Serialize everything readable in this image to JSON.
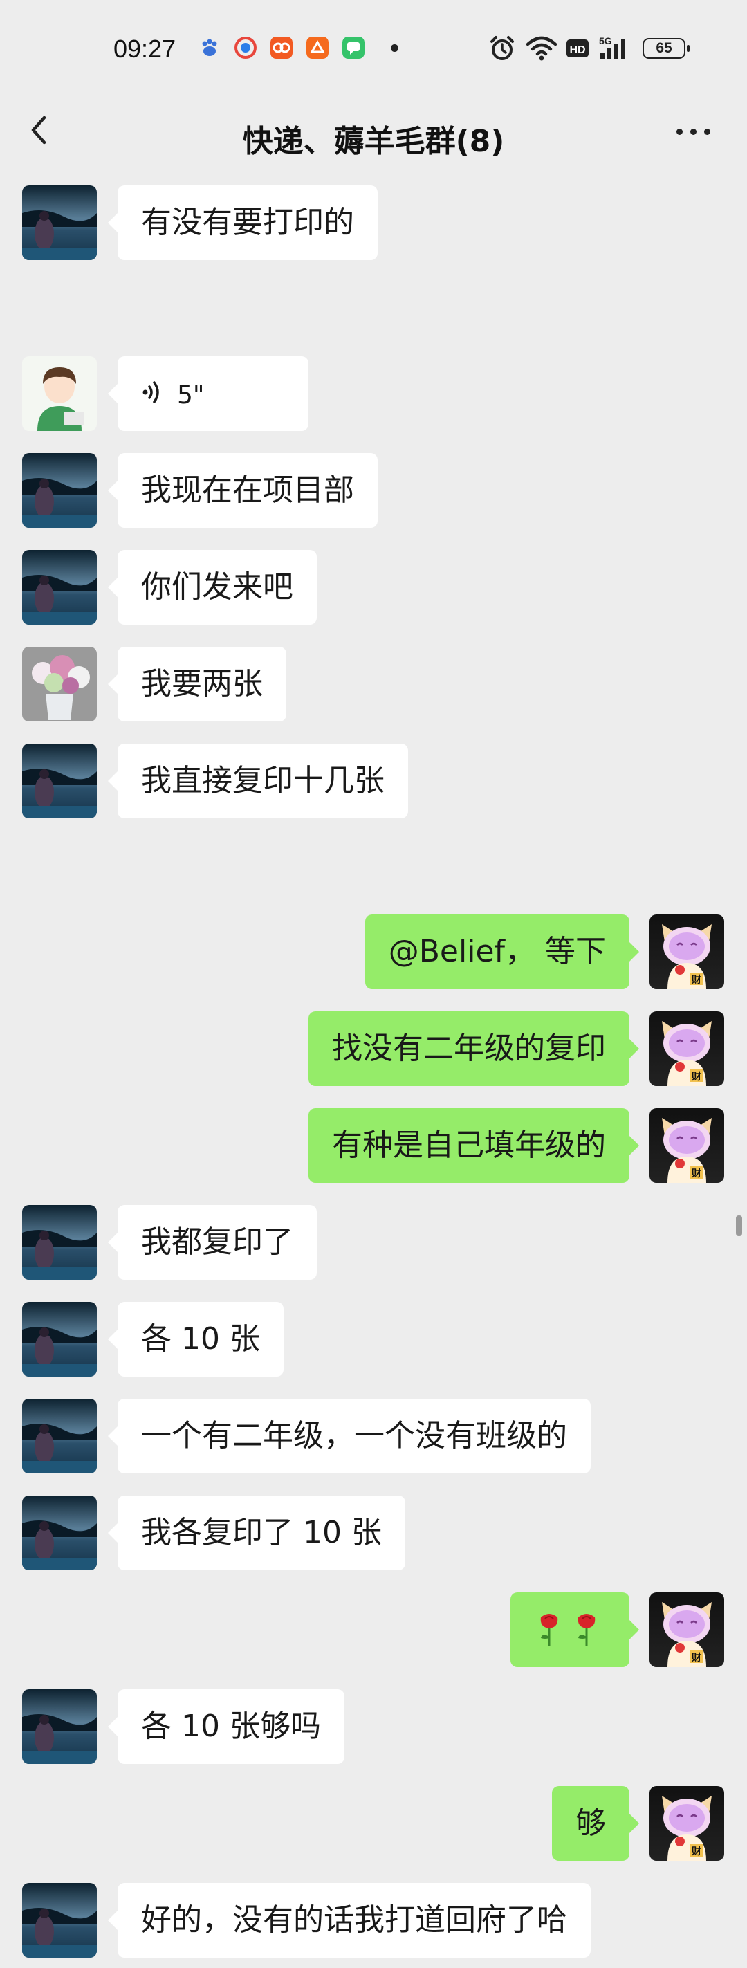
{
  "status_bar": {
    "time": "09:27",
    "battery": "65",
    "app_icon_colors": [
      "#3a72d8",
      "#e8463c",
      "#f25a22",
      "#f56a1d",
      "#35c36a"
    ],
    "icons": [
      "alarm-icon",
      "wifi-icon",
      "hd-icon",
      "5g-signal-icon",
      "battery-icon"
    ]
  },
  "header": {
    "title": "快递、薅羊毛群(8)"
  },
  "messages": [
    {
      "side": "left",
      "avatar": "lake",
      "text": "有没有要打印的"
    },
    {
      "side": "left",
      "avatar": "boy",
      "type": "voice",
      "text": "5\""
    },
    {
      "side": "left",
      "avatar": "lake",
      "text": "我现在在项目部"
    },
    {
      "side": "left",
      "avatar": "lake",
      "text": "你们发来吧"
    },
    {
      "side": "left",
      "avatar": "flowers",
      "text": "我要两张"
    },
    {
      "side": "left",
      "avatar": "lake",
      "text": "我直接复印十几张"
    },
    {
      "side": "right",
      "avatar": "cat",
      "text": "@Belief， 等下"
    },
    {
      "side": "right",
      "avatar": "cat",
      "text": "找没有二年级的复印"
    },
    {
      "side": "right",
      "avatar": "cat",
      "text": "有种是自己填年级的"
    },
    {
      "side": "left",
      "avatar": "lake",
      "text": "我都复印了"
    },
    {
      "side": "left",
      "avatar": "lake",
      "text": "各 10 张"
    },
    {
      "side": "left",
      "avatar": "lake",
      "text": "一个有二年级，一个没有班级的"
    },
    {
      "side": "left",
      "avatar": "lake",
      "text": "我各复印了 10 张"
    },
    {
      "side": "right",
      "avatar": "cat",
      "type": "emoji",
      "text": "🌹🌹"
    },
    {
      "side": "left",
      "avatar": "lake",
      "text": "各 10 张够吗"
    },
    {
      "side": "right",
      "avatar": "cat",
      "text": "够"
    },
    {
      "side": "left",
      "avatar": "lake",
      "text": "好的，没有的话我打道回府了哈"
    }
  ],
  "colors": {
    "background": "#ededed",
    "own_bubble": "#95ec69",
    "other_bubble": "#ffffff"
  }
}
